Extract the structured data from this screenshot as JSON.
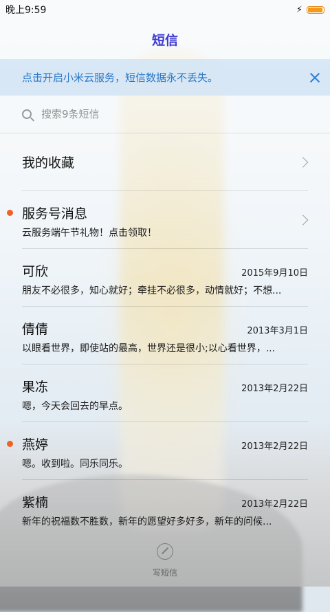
{
  "status_bar": {
    "time": "晚上9:59",
    "battery_color": "#f39a1b",
    "battery_level": 0.95
  },
  "header": {
    "title": "短信",
    "title_color": "#3f3ad1"
  },
  "banner": {
    "text": "点击开启小米云服务，短信数据永不丢失。",
    "text_color": "#2a78c8"
  },
  "search": {
    "placeholder": "搜索9条短信"
  },
  "list": {
    "favorites": {
      "label": "我的收藏"
    },
    "service": {
      "name": "服务号消息",
      "preview": "云服务端午节礼物！点击领取！",
      "unread": true
    },
    "conversations": [
      {
        "name": "可欣",
        "date": "2015年9月10日",
        "preview": "朋友不必很多，知心就好；牵挂不必很多，动情就好；不想...",
        "unread": false
      },
      {
        "name": "倩倩",
        "date": "2013年3月1日",
        "preview": "以眼看世界，即使站的最高，世界还是很小;以心看世界，...",
        "unread": false
      },
      {
        "name": "果冻",
        "date": "2013年2月22日",
        "preview": "嗯，今天会回去的早点。",
        "unread": false
      },
      {
        "name": "燕婷",
        "date": "2013年2月22日",
        "preview": "嗯。收到啦。同乐同乐。",
        "unread": true
      },
      {
        "name": "紫楠",
        "date": "2013年2月22日",
        "preview": "新年的祝福数不胜数，新年的愿望好多好多，新年的问候...",
        "unread": false
      }
    ],
    "unread_dot_color": "#f06222"
  },
  "compose": {
    "label": "写短信"
  }
}
